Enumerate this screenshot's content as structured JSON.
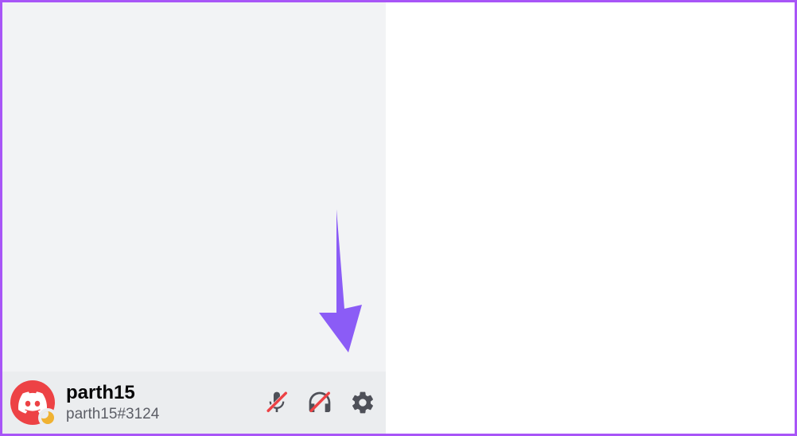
{
  "user": {
    "display_name": "parth15",
    "tag": "parth15#3124",
    "status": "idle",
    "avatar_bg": "#ed4245"
  },
  "controls": {
    "mute_name": "mic-muted-icon",
    "deafen_name": "headphones-deafened-icon",
    "settings_name": "gear-icon"
  },
  "colors": {
    "border": "#a855f7",
    "arrow": "#8b5cf6",
    "panel_bg": "#f2f3f5",
    "user_panel_bg": "#ebedef"
  }
}
